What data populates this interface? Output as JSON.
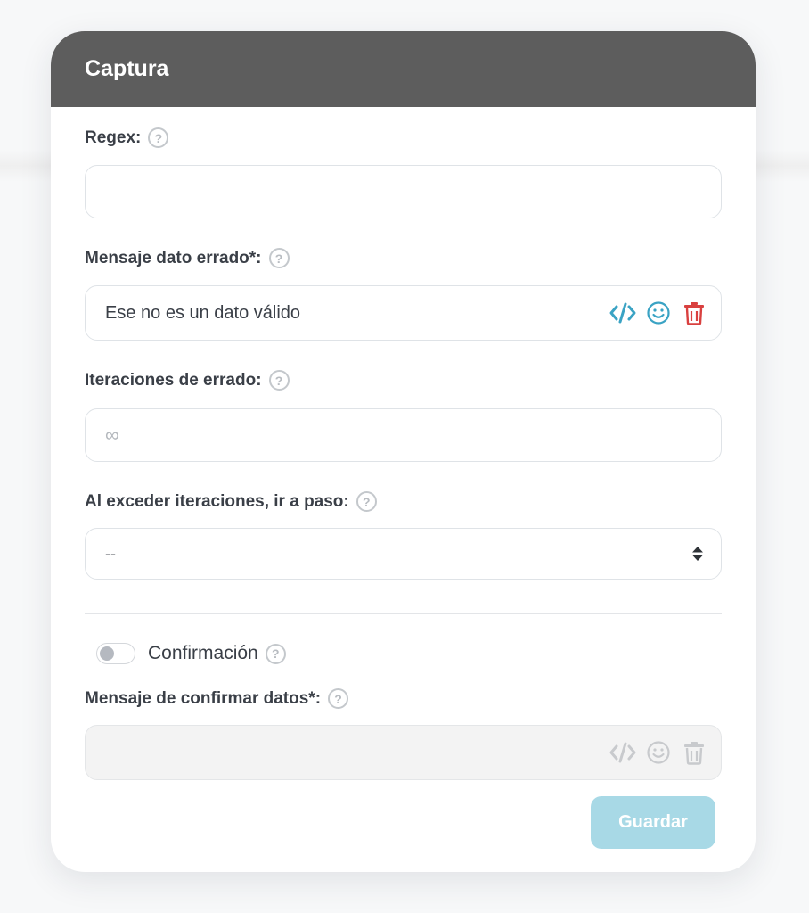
{
  "card": {
    "title": "Captura"
  },
  "regex": {
    "label": "Regex:",
    "value": ""
  },
  "error_message": {
    "label": "Mensaje dato errado*:",
    "value": "Ese no es un dato válido"
  },
  "error_iterations": {
    "label": "Iteraciones de errado:",
    "placeholder": "∞"
  },
  "exceed_step": {
    "label": "Al exceder iteraciones, ir a paso:",
    "selected": "--"
  },
  "confirmation": {
    "label": "Confirmación",
    "enabled": false
  },
  "confirm_message": {
    "label": "Mensaje de confirmar datos*:",
    "value": ""
  },
  "save_button": {
    "label": "Guardar"
  },
  "icons": {
    "help": "question-circle-icon",
    "code": "code-icon",
    "emoji": "smile-icon",
    "trash": "trash-icon",
    "sort": "sort-icon"
  },
  "colors": {
    "header_bg": "#5d5d5d",
    "accent": "#3aa3c4",
    "danger": "#d9403f",
    "disabled_icon": "#c8cacd",
    "save_button_bg": "#a8d9e6"
  }
}
